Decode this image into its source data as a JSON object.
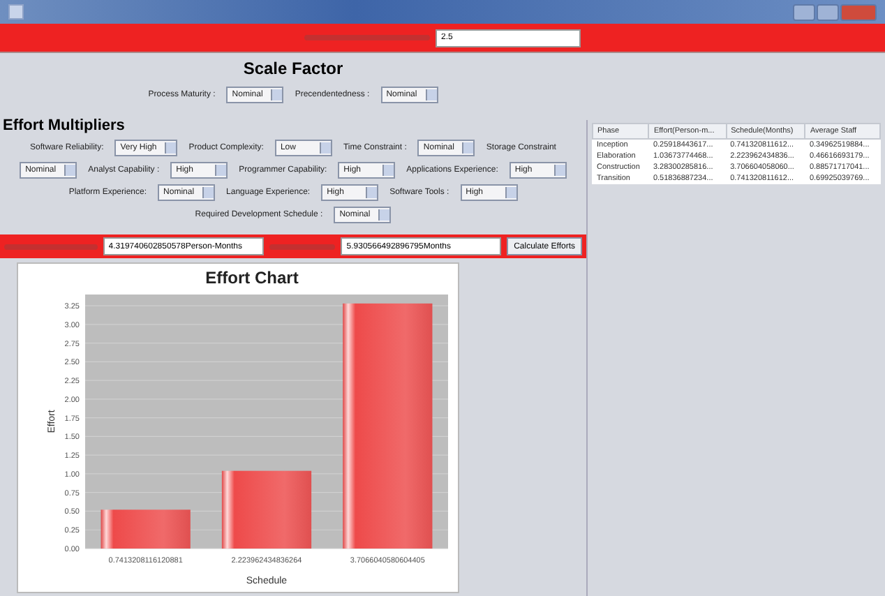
{
  "top_bar": {
    "field_value": "2.5"
  },
  "scale_factor": {
    "title": "Scale Factor",
    "fields": [
      {
        "label": "Process Maturity :",
        "value": "Nominal"
      },
      {
        "label": "Precendentedness :",
        "value": "Nominal"
      }
    ]
  },
  "effort_multipliers": {
    "title": "Effort Multipliers",
    "lines": [
      {
        "items": [
          {
            "label": "Software Reliability:",
            "value": "Very High"
          },
          {
            "label": "Product Complexity:",
            "value": "Low"
          },
          {
            "label": "Time Constraint :",
            "value": "Nominal"
          },
          {
            "label": "Storage Constraint"
          }
        ]
      },
      {
        "items": [
          {
            "value": "Nominal"
          },
          {
            "label": "Analyst Capability :",
            "value": "High"
          },
          {
            "label": "Programmer Capability:",
            "value": "High"
          },
          {
            "label": "Applications Experience:",
            "value": "High"
          }
        ]
      },
      {
        "items": [
          {
            "label": "Platform Experience:",
            "value": "Nominal"
          },
          {
            "label": "Language Experience:",
            "value": "High"
          },
          {
            "label": "Software Tools :",
            "value": "High"
          }
        ]
      },
      {
        "items": [
          {
            "label": "Required Development Schedule :",
            "value": "Nominal"
          }
        ]
      }
    ]
  },
  "results": {
    "effort": "4.319740602850578Person-Months",
    "schedule": "5.930566492896795Months",
    "button": "Calculate Efforts"
  },
  "chart": {
    "chart_data": {
      "type": "bar",
      "title": "Effort Chart",
      "xlabel": "Schedule",
      "ylabel": "Effort",
      "categories": [
        "0.7413208116120881",
        "2.223962434836264",
        "3.7066040580604405"
      ],
      "values": [
        0.52,
        1.04,
        3.28
      ],
      "ylim": [
        0,
        3.4
      ],
      "grid": true,
      "yticks": [
        {
          "value": 0,
          "label": "0.00"
        },
        {
          "value": 0.25,
          "label": "0.25"
        },
        {
          "value": 0.5,
          "label": "0.50"
        },
        {
          "value": 0.75,
          "label": "0.75"
        },
        {
          "value": 1,
          "label": "1.00"
        },
        {
          "value": 1.25,
          "label": "1.25"
        },
        {
          "value": 1.5,
          "label": "1.50"
        },
        {
          "value": 1.75,
          "label": "1.75"
        },
        {
          "value": 2,
          "label": "2.00"
        },
        {
          "value": 2.25,
          "label": "2.25"
        },
        {
          "value": 2.5,
          "label": "2.50"
        },
        {
          "value": 2.75,
          "label": "2.75"
        },
        {
          "value": 3,
          "label": "3.00"
        },
        {
          "value": 3.25,
          "label": "3.25"
        }
      ]
    }
  },
  "table": {
    "columns": [
      "Phase",
      "Effort(Person-m...",
      "Schedule(Months)",
      "Average Staff"
    ],
    "rows": [
      [
        "Inception",
        "0.25918443617...",
        "0.741320811612...",
        "0.34962519884..."
      ],
      [
        "Elaboration",
        "1.03673774468...",
        "2.223962434836...",
        "0.46616693179..."
      ],
      [
        "Construction",
        "3.28300285816...",
        "3.706604058060...",
        "0.88571717041..."
      ],
      [
        "Transition",
        "0.51836887234...",
        "0.741320811612...",
        "0.69925039769..."
      ]
    ]
  }
}
